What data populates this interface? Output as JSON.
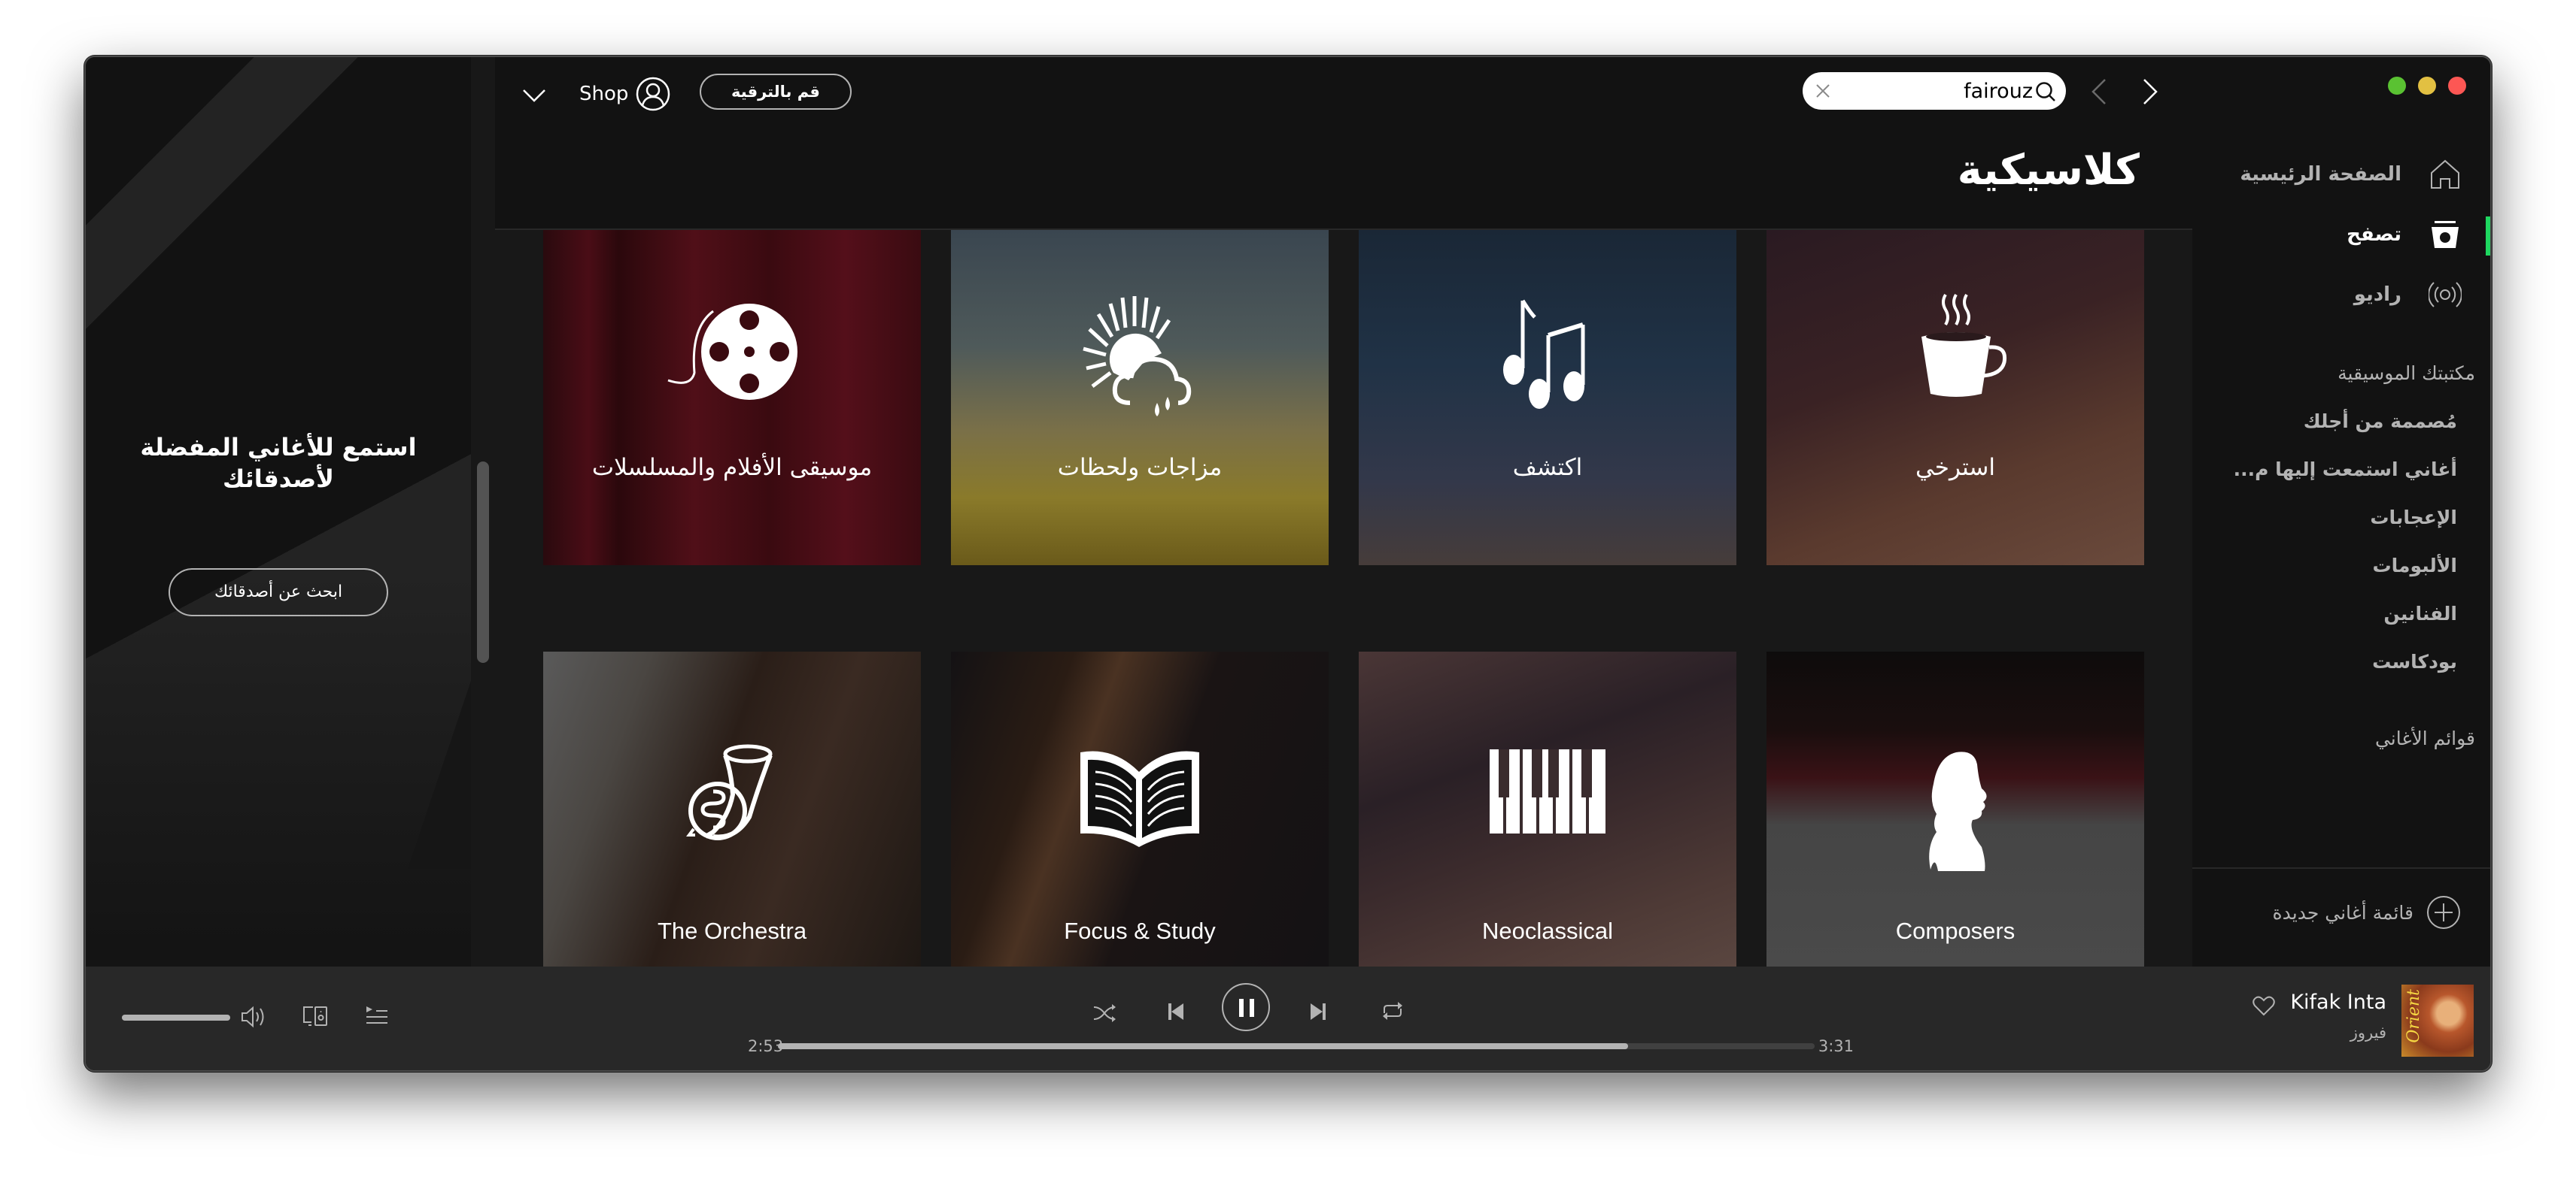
{
  "window": {
    "traffic_lights": {
      "green": "#5ac232",
      "yellow": "#e2c042",
      "red": "#fd5754"
    }
  },
  "friends_panel": {
    "title": "استمع للأغاني المفضلة لأصدقائك",
    "find_friends_button": "ابحث عن أصدقائك"
  },
  "header": {
    "user_menu_label": "Shop",
    "upgrade_button": "قم بالترقية",
    "search": {
      "value": "fairouz",
      "placeholder": ""
    },
    "page_title": "كلاسيكية"
  },
  "tiles": [
    {
      "label": "موسيقى الأفلام والمسلسلات",
      "icon": "film-reel-icon",
      "bg": "linear-gradient(90deg,#2a0a0e 0%,#4a0d16 12%,#2b080c 20%,#500f18 40%,#3a0a10 60%,#540f1a 80%,#3a0b11 100%)"
    },
    {
      "label": "مزاجات ولحظات",
      "icon": "weather-mood-icon",
      "bg": "linear-gradient(180deg,#3a4650 0%,#4f5a5a 35%,#7a7048 60%,#8a7a2a 80%,#6a5a1a 100%)"
    },
    {
      "label": "اكتشف",
      "icon": "music-notes-icon",
      "bg": "linear-gradient(180deg,#1a2736 0%,#203246 40%,#33384a 75%,#463c3a 100%)"
    },
    {
      "label": "استرخي",
      "icon": "coffee-cup-icon",
      "bg": "linear-gradient(160deg,#2a1a22 0%,#3a2224 40%,#5a3a2e 70%,#6a4a3c 100%)"
    },
    {
      "label": "The Orchestra",
      "icon": "french-horn-icon",
      "bg": "linear-gradient(110deg,#5a5a5a 0%,#4a4642 22%,#2a1e18 45%,#3a2a22 65%,#1e1814 100%)"
    },
    {
      "label": "Focus & Study",
      "icon": "open-book-icon",
      "bg": "linear-gradient(110deg,#141214 0%,#2a1c14 25%,#4a3222 35%,#1a1414 55%,#141214 100%)"
    },
    {
      "label": "Neoclassical",
      "icon": "piano-keys-icon",
      "bg": "linear-gradient(160deg,#4a3636 0%,#2a2026 35%,#3a2a2c 55%,#4e3a36 80%,#5a4640 100%)"
    },
    {
      "label": "Composers",
      "icon": "composer-silhouette-icon",
      "bg": "linear-gradient(180deg,#0e0c0c 0%,#1a0e0e 25%,#3a1216 40%,#454545 55%,#4a4a4a 100%)"
    }
  ],
  "sidebar": {
    "nav": [
      {
        "label": "الصفحة الرئيسية",
        "icon": "home-icon",
        "active": false
      },
      {
        "label": "تصفح",
        "icon": "browse-icon",
        "active": true
      },
      {
        "label": "راديو",
        "icon": "radio-icon",
        "active": false
      }
    ],
    "library_heading": "مكتبتك الموسيقية",
    "library_items": [
      "مُصممة من أجلك",
      "أغاني استمعت إليها م...",
      "الإعجابات",
      "الألبومات",
      "الفنانين",
      "بودكاست"
    ],
    "playlists_heading": "قوائم الأغاني",
    "new_playlist": "قائمة أغاني جديدة",
    "accent_color": "#1ed760"
  },
  "player": {
    "track_title": "Kifak Inta",
    "artist": "فيروز",
    "album_art_text": "Orient",
    "current_time": "2:53",
    "total_time": "3:31",
    "progress_fraction": 0.82,
    "volume_fraction": 1.0,
    "is_playing": true
  }
}
